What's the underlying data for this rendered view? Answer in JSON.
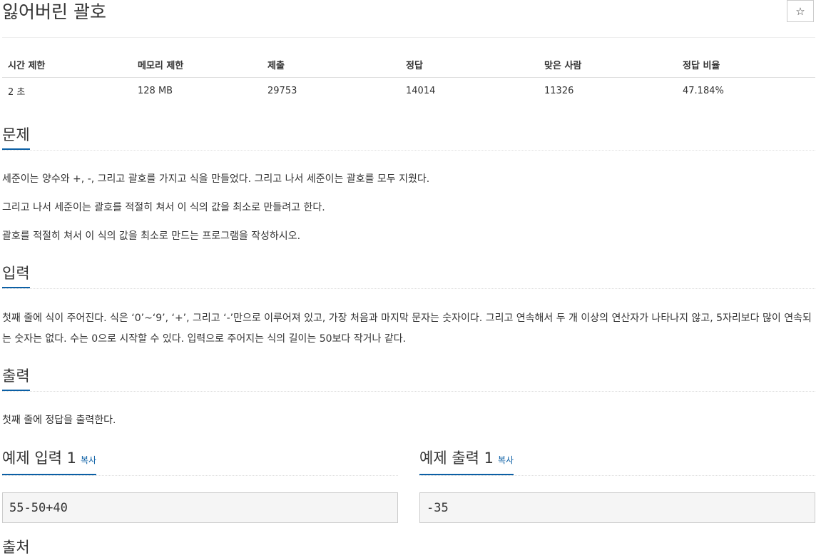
{
  "problem": {
    "title": "잃어버린 괄호",
    "star_label": "☆"
  },
  "stats": {
    "headers": [
      "시간 제한",
      "메모리 제한",
      "제출",
      "정답",
      "맞은 사람",
      "정답 비율"
    ],
    "values": [
      "2 초",
      "128 MB",
      "29753",
      "14014",
      "11326",
      "47.184%"
    ]
  },
  "sections": {
    "description": {
      "title": "문제",
      "paragraphs": [
        "세준이는 양수와 +, -, 그리고 괄호를 가지고 식을 만들었다. 그리고 나서 세준이는 괄호를 모두 지웠다.",
        "그리고 나서 세준이는 괄호를 적절히 쳐서 이 식의 값을 최소로 만들려고 한다.",
        "괄호를 적절히 쳐서 이 식의 값을 최소로 만드는 프로그램을 작성하시오."
      ]
    },
    "input": {
      "title": "입력",
      "text": "첫째 줄에 식이 주어진다. 식은 ‘0’~‘9’, ‘+’, 그리고 ‘-’만으로 이루어져 있고, 가장 처음과 마지막 문자는 숫자이다. 그리고 연속해서 두 개 이상의 연산자가 나타나지 않고, 5자리보다 많이 연속되는 숫자는 없다. 수는 0으로 시작할 수 있다. 입력으로 주어지는 식의 길이는 50보다 작거나 같다."
    },
    "output": {
      "title": "출력",
      "text": "첫째 줄에 정답을 출력한다."
    },
    "source": {
      "title": "출처"
    }
  },
  "samples": {
    "input": {
      "title": "예제 입력 1",
      "copy_label": "복사",
      "content": "55-50+40"
    },
    "output": {
      "title": "예제 출력 1",
      "copy_label": "복사",
      "content": "-35"
    }
  },
  "colors": {
    "accent": "#0b5fa5",
    "text": "#333333",
    "sample_bg": "#f5f5f5"
  }
}
